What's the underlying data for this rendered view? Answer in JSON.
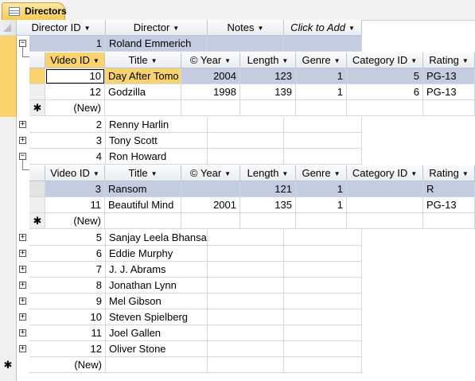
{
  "tab": {
    "label": "Directors",
    "icon": "table-icon"
  },
  "main_columns": [
    "Director ID",
    "Director",
    "Notes",
    "Click to Add"
  ],
  "directors": [
    {
      "id": "1",
      "name": "Roland Emmerich"
    },
    {
      "id": "2",
      "name": "Renny Harlin"
    },
    {
      "id": "3",
      "name": "Tony Scott"
    },
    {
      "id": "4",
      "name": "Ron Howard"
    },
    {
      "id": "5",
      "name": "Sanjay Leela Bhansa"
    },
    {
      "id": "6",
      "name": "Eddie Murphy"
    },
    {
      "id": "7",
      "name": "J. J. Abrams"
    },
    {
      "id": "8",
      "name": "Jonathan Lynn"
    },
    {
      "id": "9",
      "name": "Mel Gibson"
    },
    {
      "id": "10",
      "name": "Steven Spielberg"
    },
    {
      "id": "11",
      "name": "Joel Gallen"
    },
    {
      "id": "12",
      "name": "Oliver Stone"
    }
  ],
  "new_label": "(New)",
  "sub_columns": [
    "Video ID",
    "Title",
    "© Year",
    "Length",
    "Genre",
    "Category ID",
    "Rating"
  ],
  "sub1": [
    {
      "video_id": "10",
      "title": "Day After Tomo",
      "year": "2004",
      "length": "123",
      "genre": "1",
      "category": "5",
      "rating": "PG-13"
    },
    {
      "video_id": "12",
      "title": "Godzilla",
      "year": "1998",
      "length": "139",
      "genre": "1",
      "category": "6",
      "rating": "PG-13"
    }
  ],
  "sub2": [
    {
      "video_id": "3",
      "title": "Ransom",
      "year": "",
      "length": "121",
      "genre": "1",
      "category": "",
      "rating": "R"
    },
    {
      "video_id": "11",
      "title": "Beautiful Mind",
      "year": "2001",
      "length": "135",
      "genre": "1",
      "category": "",
      "rating": "PG-13"
    }
  ],
  "colors": {
    "accent": "#fbd36e",
    "selection": "#c4cce0"
  }
}
